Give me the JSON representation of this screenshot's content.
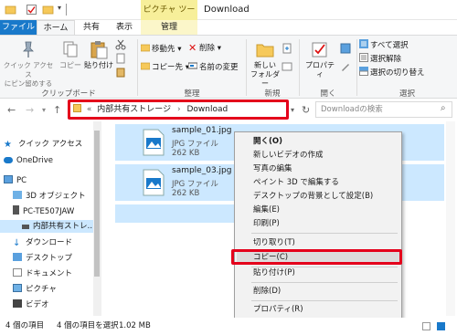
{
  "window": {
    "title": "Download",
    "picture_tools_label": "ピクチャ ツール"
  },
  "tabs": {
    "file": "ファイル",
    "home": "ホーム",
    "share": "共有",
    "view": "表示",
    "manage": "管理"
  },
  "ribbon": {
    "clipboard": {
      "pin_quick_access": "クイック アクセス\nにピン留めする",
      "copy": "コピー",
      "paste": "貼り付け",
      "group_label": "クリップボード"
    },
    "organize": {
      "move_to": "移動先 ▾",
      "copy_to": "コピー先 ▾",
      "delete": "削除 ▾",
      "rename": "名前の変更",
      "group_label": "整理"
    },
    "new": {
      "new_folder": "新しい\nフォルダー",
      "group_label": "新規"
    },
    "open": {
      "properties": "プロパティ",
      "group_label": "開く"
    },
    "select": {
      "select_all": "すべて選択",
      "select_none": "選択解除",
      "invert_selection": "選択の切り替え",
      "group_label": "選択"
    }
  },
  "address": {
    "path_prefix": "«",
    "crumb_storage": "内部共有ストレージ",
    "separator": "›",
    "crumb_download": "Download",
    "search_placeholder": "Downloadの検索"
  },
  "sidebar": {
    "items": [
      {
        "label": "クイック アクセス"
      },
      {
        "label": "OneDrive"
      },
      {
        "label": "PC"
      },
      {
        "label": "3D オブジェクト"
      },
      {
        "label": "PC-TE507JAW"
      },
      {
        "label": "内部共有ストレ…"
      },
      {
        "label": "ダウンロード"
      },
      {
        "label": "デスクトップ"
      },
      {
        "label": "ドキュメント"
      },
      {
        "label": "ピクチャ"
      },
      {
        "label": "ビデオ"
      }
    ]
  },
  "files": [
    {
      "name": "sample_01.jpg",
      "type": "JPG ファイル",
      "size": "262 KB"
    },
    {
      "name": "sample_03.jpg",
      "type": "JPG ファイル",
      "size": "262 KB"
    }
  ],
  "context_menu": {
    "items": [
      {
        "label": "開く(O)"
      },
      {
        "label": "新しいビデオの作成"
      },
      {
        "label": "写真の編集"
      },
      {
        "label": "ペイント 3D で編集する"
      },
      {
        "label": "デスクトップの背景として設定(B)"
      },
      {
        "label": "編集(E)"
      },
      {
        "label": "印刷(P)"
      },
      {
        "label": "切り取り(T)"
      },
      {
        "label": "コピー(C)"
      },
      {
        "label": "貼り付け(P)"
      },
      {
        "label": "削除(D)"
      },
      {
        "label": "プロパティ(R)"
      }
    ]
  },
  "status": {
    "item_count": "4 個の項目",
    "selected": "4 個の項目を選択",
    "size": "1.02 MB"
  },
  "colors": {
    "accent": "#1979ca",
    "highlight": "#e4001b",
    "selection": "#cce8ff"
  }
}
